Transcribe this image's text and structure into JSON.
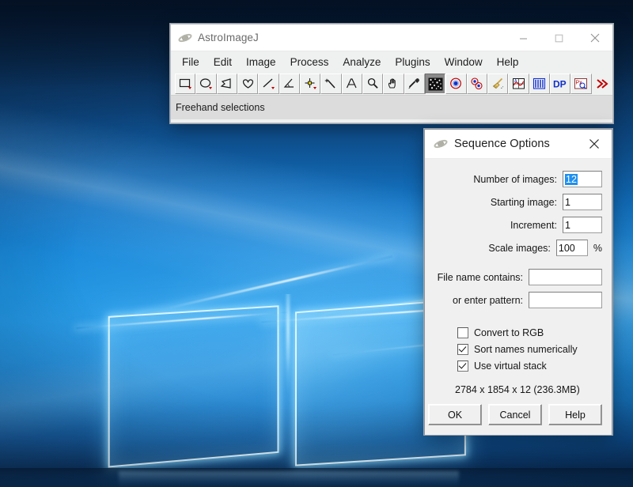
{
  "desktop": {
    "name": "windows-10-hero-wallpaper"
  },
  "main_window": {
    "title": "AstroImageJ",
    "icon": "saturn-planet-icon",
    "controls": {
      "minimize": "minimize-icon",
      "maximize": "maximize-icon",
      "close": "close-icon"
    },
    "menu": [
      {
        "label": "File"
      },
      {
        "label": "Edit"
      },
      {
        "label": "Image"
      },
      {
        "label": "Process"
      },
      {
        "label": "Analyze"
      },
      {
        "label": "Plugins"
      },
      {
        "label": "Window"
      },
      {
        "label": "Help"
      }
    ],
    "toolbar": [
      {
        "name": "rectangle-tool",
        "icon": "rectangle-icon",
        "active": false,
        "dropdown": true
      },
      {
        "name": "oval-tool",
        "icon": "oval-icon",
        "active": false,
        "dropdown": true
      },
      {
        "name": "polygon-tool",
        "icon": "polygon-icon",
        "active": false,
        "dropdown": false
      },
      {
        "name": "freehand-tool",
        "icon": "freehand-icon",
        "active": false,
        "dropdown": false
      },
      {
        "name": "line-tool",
        "icon": "line-icon",
        "active": false,
        "dropdown": true
      },
      {
        "name": "angle-tool",
        "icon": "angle-icon",
        "active": false,
        "dropdown": false
      },
      {
        "name": "point-tool",
        "icon": "point-icon",
        "active": false,
        "dropdown": true
      },
      {
        "name": "wand-tool",
        "icon": "magic-wand-icon",
        "active": false,
        "dropdown": false
      },
      {
        "name": "text-tool",
        "icon": "text-a-icon",
        "active": false,
        "dropdown": false
      },
      {
        "name": "magnifier-tool",
        "icon": "magnifier-icon",
        "active": false,
        "dropdown": false
      },
      {
        "name": "hand-tool",
        "icon": "hand-icon",
        "active": false,
        "dropdown": false
      },
      {
        "name": "dropper-tool",
        "icon": "eyedropper-icon",
        "active": false,
        "dropdown": false
      },
      {
        "name": "star-field-tool",
        "icon": "star-field-icon",
        "active": true,
        "dropdown": false
      },
      {
        "name": "aperture-photometry-tool",
        "icon": "aperture-icon",
        "active": false,
        "dropdown": false
      },
      {
        "name": "multi-aperture-tool",
        "icon": "multi-aperture-icon",
        "active": false,
        "dropdown": false
      },
      {
        "name": "clear-overlay-tool",
        "icon": "broom-icon",
        "active": false,
        "dropdown": false
      },
      {
        "name": "plot-tool",
        "icon": "plot-icon",
        "active": false,
        "dropdown": false
      },
      {
        "name": "seeing-profile-tool",
        "icon": "seeing-profile-icon",
        "active": false,
        "dropdown": false
      },
      {
        "name": "data-processor-tool",
        "icon": "dp-text-icon",
        "active": false,
        "dropdown": false,
        "text": "DP"
      },
      {
        "name": "pixel-scale-tool",
        "icon": "px-magnifier-icon",
        "active": false,
        "dropdown": false,
        "text": "Px"
      },
      {
        "name": "more-tools",
        "icon": "double-chevron-right-icon",
        "active": false,
        "dropdown": false,
        "text": "»"
      }
    ],
    "status": "Freehand selections"
  },
  "dialog": {
    "title": "Sequence Options",
    "icon": "saturn-planet-icon",
    "close_icon": "close-icon",
    "fields": [
      {
        "label": "Number of images:",
        "value": "12",
        "selected": true,
        "width": "num"
      },
      {
        "label": "Starting image:",
        "value": "1",
        "selected": false,
        "width": "num"
      },
      {
        "label": "Increment:",
        "value": "1",
        "selected": false,
        "width": "num"
      },
      {
        "label": "Scale images:",
        "value": "100",
        "selected": false,
        "width": "scale",
        "suffix": "%"
      },
      {
        "label": "File name contains:",
        "value": "",
        "placeholder": "",
        "selected": false,
        "width": "text"
      },
      {
        "label": "or enter pattern:",
        "value": "",
        "placeholder": "",
        "selected": false,
        "width": "text"
      }
    ],
    "checkboxes": [
      {
        "label": "Convert to RGB",
        "checked": false
      },
      {
        "label": "Sort names numerically",
        "checked": true
      },
      {
        "label": "Use virtual stack",
        "checked": true
      }
    ],
    "dimensions": "2784 x 1854 x 12 (236.3MB)",
    "buttons": [
      {
        "label": "OK",
        "name": "ok-button"
      },
      {
        "label": "Cancel",
        "name": "cancel-button"
      },
      {
        "label": "Help",
        "name": "help-button"
      }
    ]
  },
  "colors": {
    "accent_blue": "#1e90f0",
    "window_bg": "#f0f0f0",
    "titlebar_bg": "#ffffff",
    "statusbar_bg": "#dcdcdc",
    "desktop_blue": "#1f93e0",
    "tool_red": "#c00000",
    "tool_dp_blue": "#1030c8"
  }
}
